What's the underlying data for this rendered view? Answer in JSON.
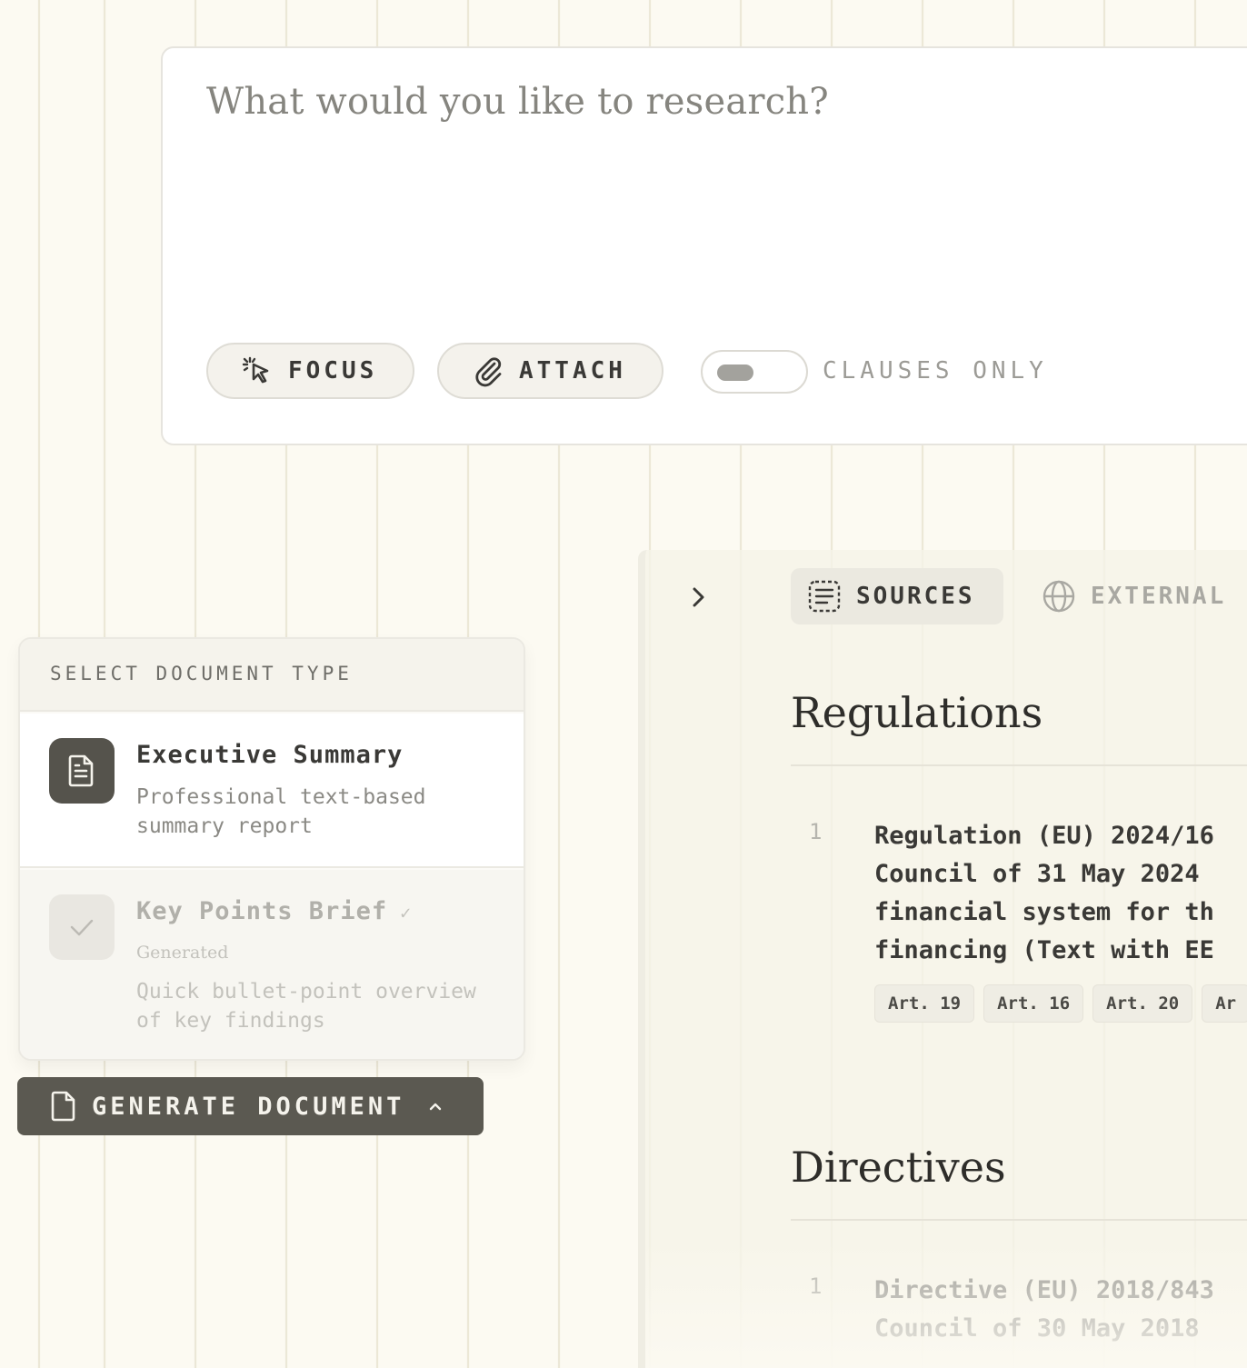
{
  "prompt": {
    "placeholder": "What would you like to research?",
    "focus_label": "FOCUS",
    "attach_label": "ATTACH",
    "clauses_toggle": {
      "label": "CLAUSES ONLY",
      "on": false
    }
  },
  "sources_panel": {
    "tabs": [
      {
        "label": "SOURCES",
        "active": true,
        "icon": "list-icon"
      },
      {
        "label": "EXTERNAL",
        "active": false,
        "icon": "globe-icon"
      }
    ],
    "sections": [
      {
        "heading": "Regulations",
        "items": [
          {
            "number": "1",
            "lines": [
              "Regulation (EU) 2024/16",
              "Council of 31 May 2024",
              "financial system for th",
              "financing (Text with EE"
            ],
            "articles": [
              "Art. 19",
              "Art. 16",
              "Art. 20",
              "Ar"
            ]
          }
        ]
      },
      {
        "heading": "Directives",
        "items": [
          {
            "number": "1",
            "lines": [
              "Directive (EU) 2018/843",
              "Council of 30 May 2018"
            ]
          }
        ]
      }
    ]
  },
  "doc_menu": {
    "title": "SELECT DOCUMENT TYPE",
    "options": [
      {
        "title": "Executive Summary",
        "description": "Professional text-based summary report",
        "icon": "document-icon",
        "selected": true
      },
      {
        "title": "Key Points Brief",
        "status": "Generated",
        "description": "Quick bullet-point overview of key findings",
        "icon": "check-icon",
        "check_mark": "✓"
      }
    ]
  },
  "generate_button": {
    "label": "GENERATE DOCUMENT",
    "caret": "^"
  }
}
